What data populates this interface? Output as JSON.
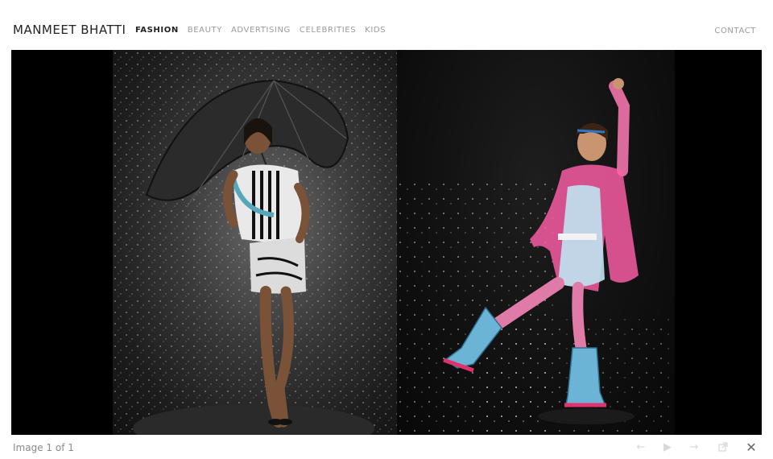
{
  "header": {
    "logo": "MANMEET BHATTI",
    "nav": [
      {
        "label": "FASHION",
        "active": true
      },
      {
        "label": "BEAUTY",
        "active": false
      },
      {
        "label": "ADVERTISING",
        "active": false
      },
      {
        "label": "CELEBRITIES",
        "active": false
      },
      {
        "label": "KIDS",
        "active": false
      }
    ],
    "contact": "CONTACT"
  },
  "viewer": {
    "counter": "Image 1 of 1",
    "controls": [
      "prev-arrow-icon",
      "play-icon",
      "next-arrow-icon",
      "popout-icon",
      "close-icon"
    ]
  },
  "colors": {
    "active_nav": "#222222",
    "inactive_nav": "#9a9a9a",
    "stage_bg": "#000000",
    "raincoat": "#ff5fa8",
    "boots": "#6bb4d6"
  }
}
